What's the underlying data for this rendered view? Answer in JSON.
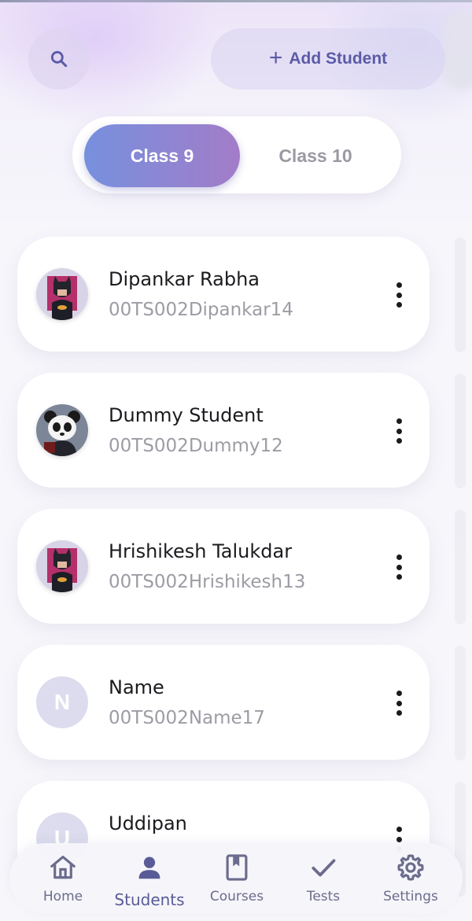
{
  "header": {
    "search_icon": "search-icon",
    "add_student_label": "Add Student",
    "add_icon": "plus-icon"
  },
  "class_tabs": [
    {
      "label": "Class 9",
      "selected": true
    },
    {
      "label": "Class 10",
      "selected": false
    }
  ],
  "students": [
    {
      "name": "Dipankar Rabha",
      "id": "00TS002Dipankar14",
      "avatar": "batman-avatar"
    },
    {
      "name": "Dummy Student",
      "id": "00TS002Dummy12",
      "avatar": "panda-avatar"
    },
    {
      "name": "Hrishikesh Talukdar",
      "id": "00TS002Hrishikesh13",
      "avatar": "batman-avatar"
    },
    {
      "name": "Name",
      "id": "00TS002Name17",
      "avatar": "initial",
      "initial": "N"
    },
    {
      "name": "Uddipan",
      "id": "",
      "avatar": "initial",
      "initial": "U"
    }
  ],
  "nav": [
    {
      "label": "Home",
      "icon": "home-icon",
      "active": false
    },
    {
      "label": "Students",
      "icon": "person-icon",
      "active": true
    },
    {
      "label": "Courses",
      "icon": "book-icon",
      "active": false
    },
    {
      "label": "Tests",
      "icon": "check-icon",
      "active": false
    },
    {
      "label": "Settings",
      "icon": "gear-icon",
      "active": false
    }
  ],
  "colors": {
    "accent": "#595b98",
    "gradient_start": "#7690de",
    "gradient_end": "#a37cc8"
  }
}
